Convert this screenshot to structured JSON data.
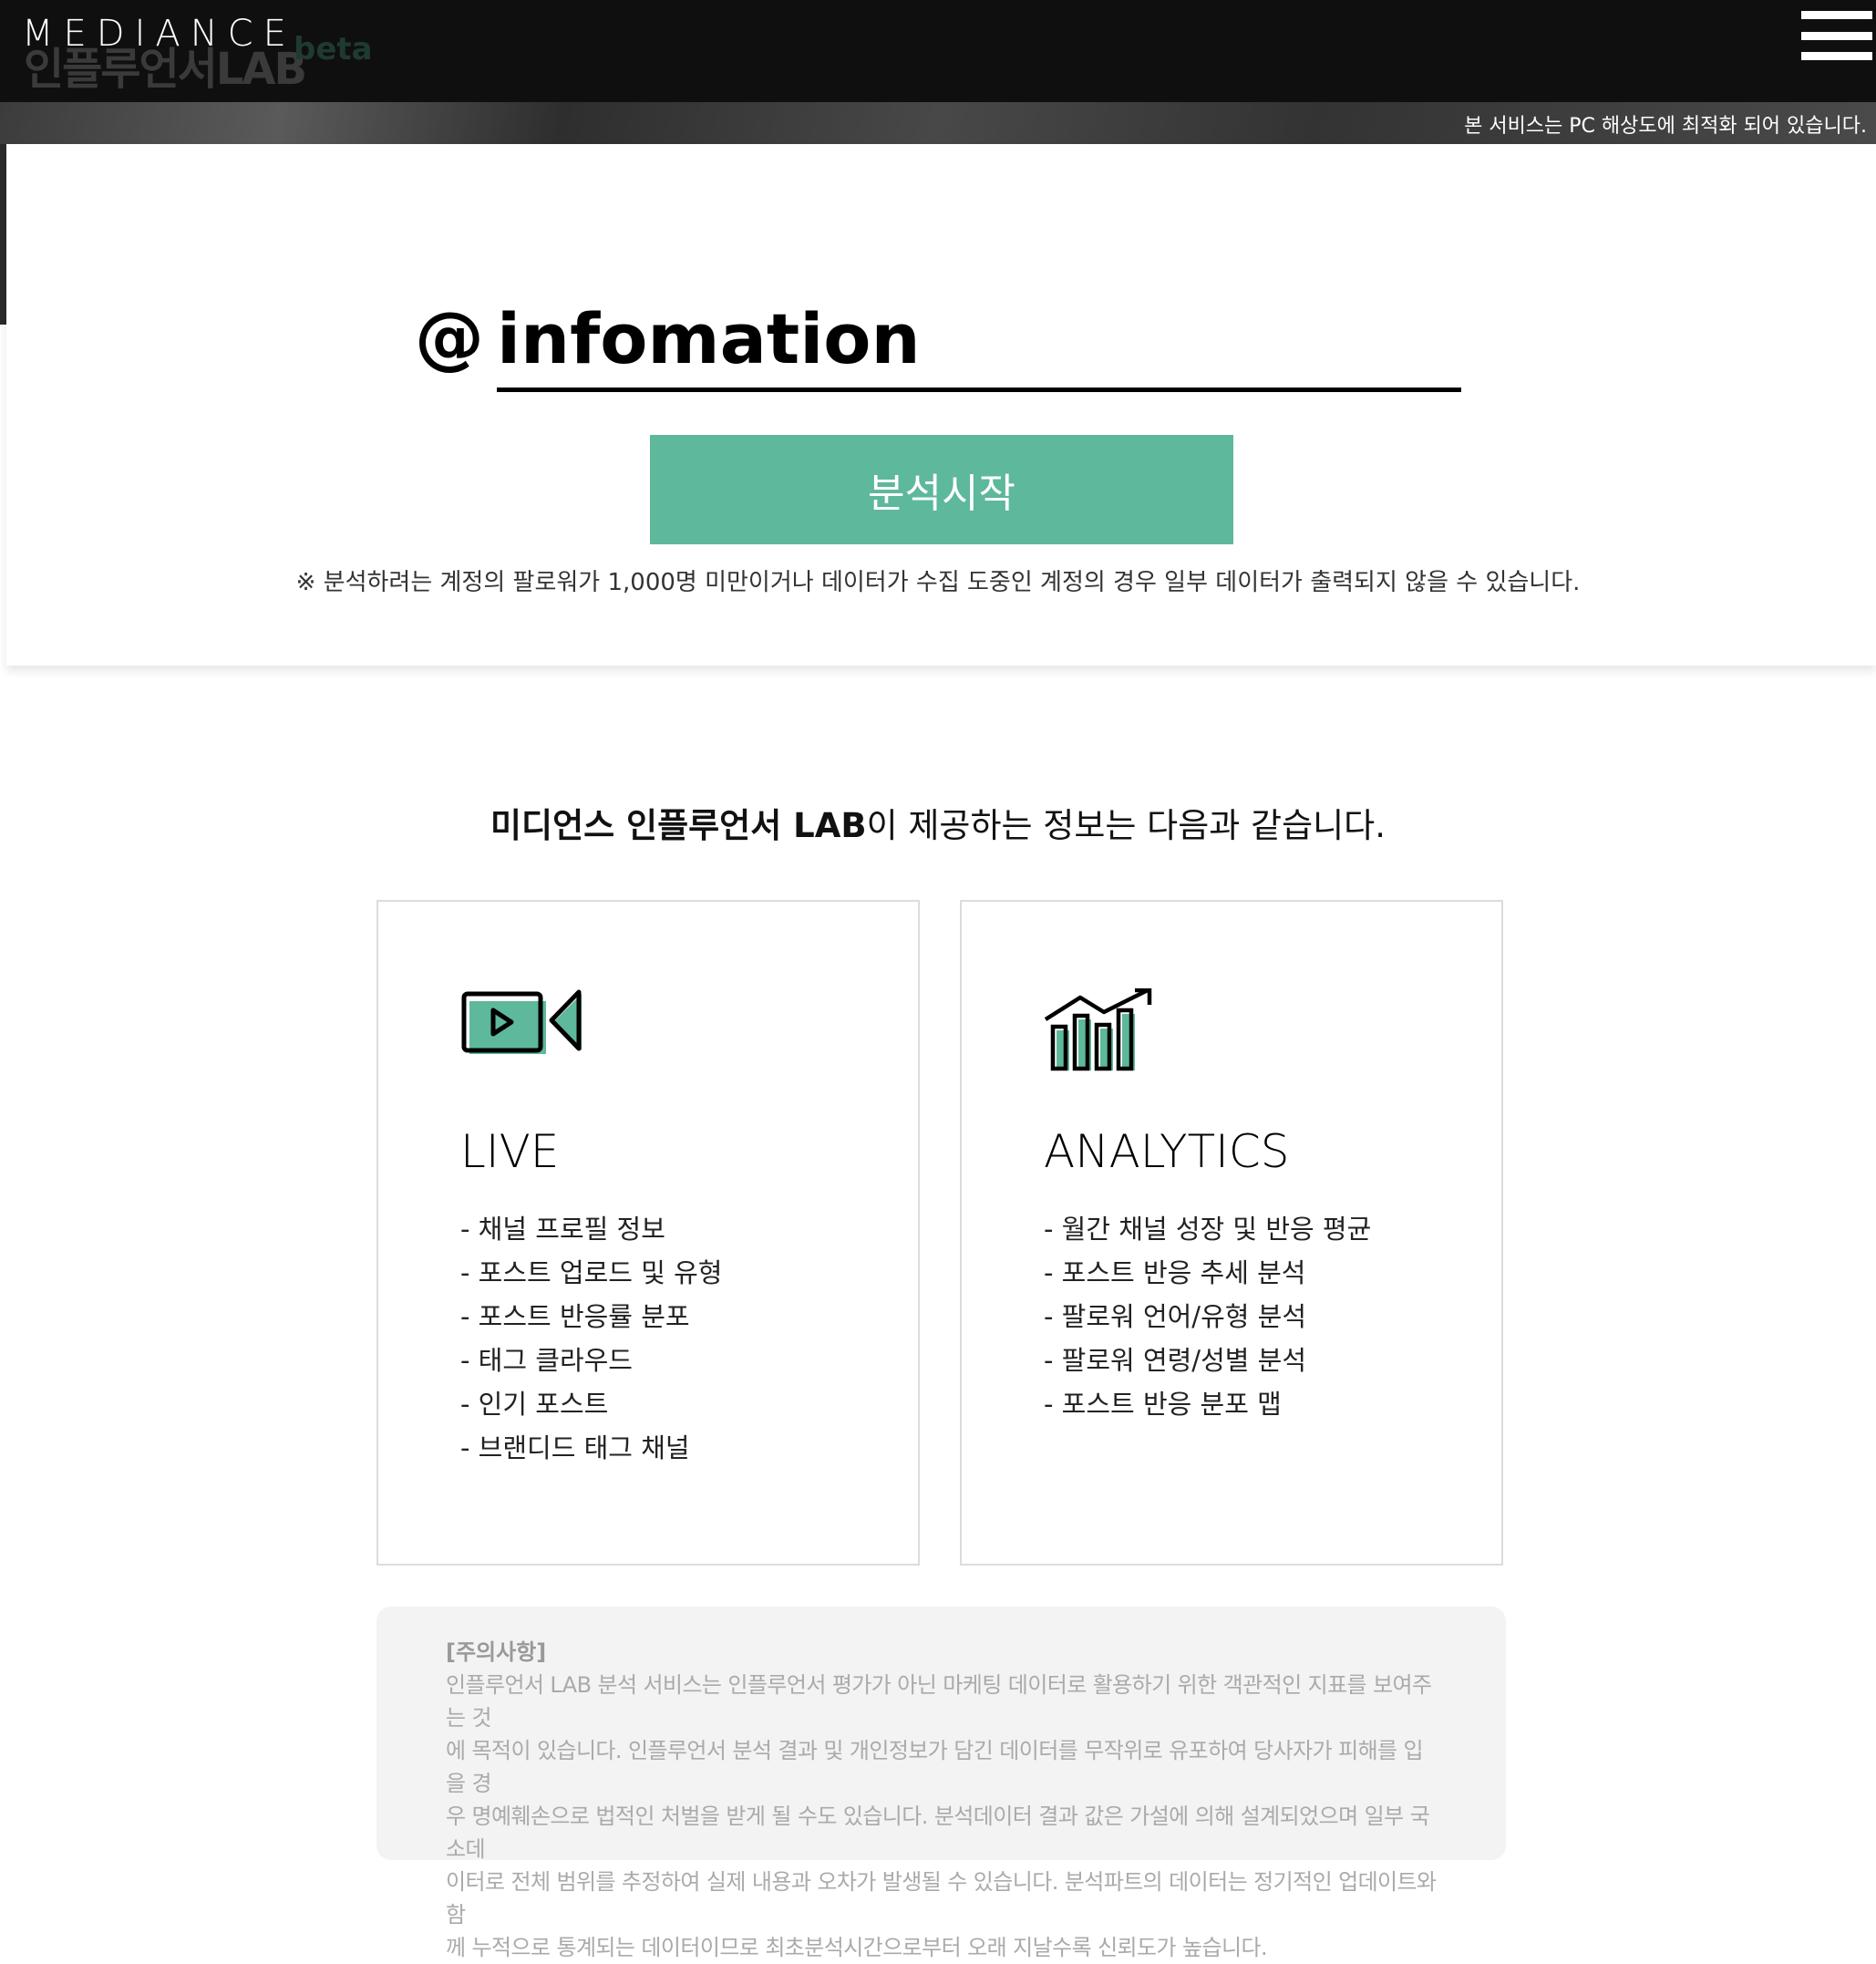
{
  "header": {
    "logo_text": "MEDIANCE",
    "subtitle_ghost": "인플루언서LAB",
    "beta_label": "beta"
  },
  "notice": {
    "text": "본 서비스는 PC 해상도에 최적화 되어 있습니다."
  },
  "search": {
    "at_symbol": "@",
    "account_value": "infomation",
    "start_button_label": "분석시작",
    "warning": "※ 분석하려는 계정의 팔로워가 1,000명 미만이거나 데이터가 수집 도중인 계정의 경우 일부 데이터가 출력되지 않을 수 있습니다."
  },
  "info": {
    "title_bold": "미디언스 인플루언서 LAB",
    "title_rest": "이 제공하는 정보는 다음과 같습니다.",
    "cards": [
      {
        "title": "LIVE",
        "icon": "video-camera-icon",
        "items": [
          "- 채널 프로필 정보",
          "- 포스트 업로드 및 유형",
          "- 포스트 반응률 분포",
          "- 태그 클라우드",
          "- 인기 포스트",
          "- 브랜디드 태그 채널"
        ]
      },
      {
        "title": "ANALYTICS",
        "icon": "bar-chart-trend-icon",
        "items": [
          "- 월간 채널 성장 및 반응 평균",
          "- 포스트 반응 추세 분석",
          "- 팔로워 언어/유형 분석",
          "- 팔로워 연령/성별 분석",
          "- 포스트 반응 분포 맵"
        ]
      }
    ]
  },
  "caution": {
    "title": "[주의사항]",
    "lines": [
      "인플루언서 LAB 분석 서비스는 인플루언서 평가가 아닌 마케팅 데이터로 활용하기 위한 객관적인 지표를 보여주는 것",
      "에 목적이 있습니다. 인플루언서 분석 결과 및 개인정보가 담긴 데이터를 무작위로 유포하여 당사자가 피해를 입을 경",
      "우 명예훼손으로 법적인 처벌을 받게 될 수도 있습니다. 분석데이터 결과 값은 가설에 의해 설계되었으며 일부 국소데",
      "이터로 전체 범위를 추정하여 실제 내용과 오차가 발생될 수 있습니다. 분석파트의 데이터는 정기적인 업데이트와 함",
      "께 누적으로 통계되는 데이터이므로 최초분석시간으로부터 오래 지날수록 신뢰도가 높습니다."
    ]
  },
  "colors": {
    "accent": "#5eb89b",
    "topbar": "#0f0f0f"
  }
}
